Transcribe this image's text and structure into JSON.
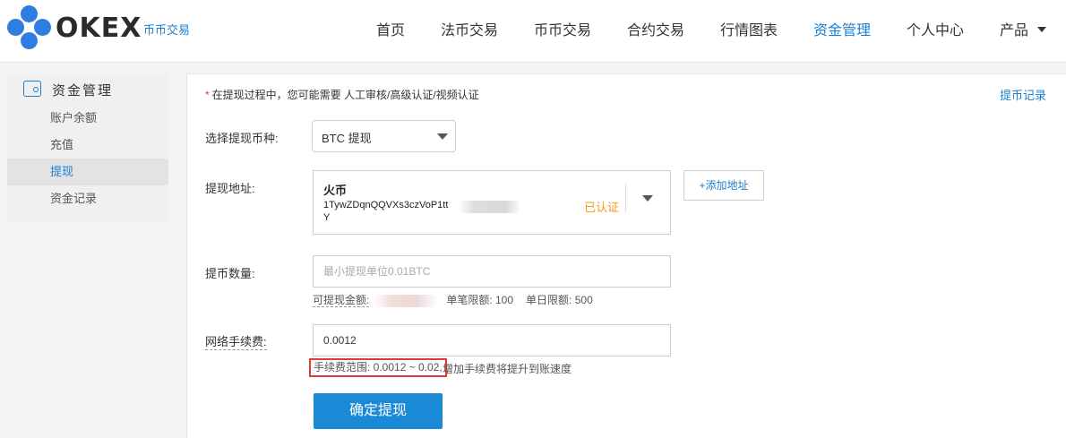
{
  "header": {
    "logo_text": "OKEX",
    "logo_sub": "币币交易",
    "nav": [
      "首页",
      "法币交易",
      "币币交易",
      "合约交易",
      "行情图表",
      "资金管理",
      "个人中心",
      "产品"
    ],
    "active_nav": "资金管理",
    "accent_color": "#1a7fd1"
  },
  "sidebar": {
    "title": "资金管理",
    "items": [
      {
        "label": "账户余额"
      },
      {
        "label": "充值"
      },
      {
        "label": "提现",
        "active": true
      },
      {
        "label": "资金记录"
      }
    ]
  },
  "form": {
    "notice_star": "*",
    "notice": "在提现过程中，您可能需要 人工审核/高级认证/视频认证",
    "record_link": "提币记录",
    "currency_label": "选择提现币种:",
    "currency_value": "BTC 提现",
    "address_label": "提现地址:",
    "address_name": "火币",
    "address_line1": "1TywZDqnQQVXs3czVoP1tt",
    "address_line2": "Y",
    "address_status": "已认证",
    "add_address": "+添加地址",
    "amount_label": "提币数量:",
    "amount_placeholder": "最小提现单位0.01BTC",
    "available_label": "可提现金额:",
    "single_limit": "单笔限额: 100",
    "daily_limit": "单日限额: 500",
    "fee_label": "网络手续费:",
    "fee_value": "0.0012",
    "fee_range": "手续费范围: 0.0012 ~ 0.02,",
    "fee_tip": "增加手续费将提升到账速度",
    "confirm": "确定提现"
  },
  "icons": {
    "wallet": "wallet-icon",
    "dropdown": "chevron-down-icon"
  }
}
